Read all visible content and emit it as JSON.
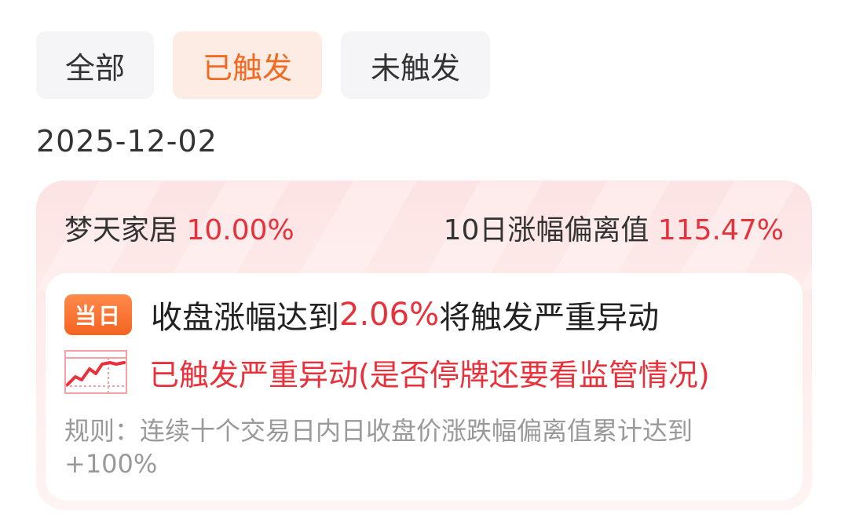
{
  "tabs": {
    "all": "全部",
    "triggered": "已触发",
    "untriggered": "未触发"
  },
  "date": "2025-12-02",
  "stock": {
    "name": "梦天家居",
    "change": "10.00%",
    "deviation_label": "10日涨幅偏离值",
    "deviation_value": "115.47%"
  },
  "alert": {
    "badge": "当日",
    "prefix": "收盘涨幅达到",
    "threshold": "2.06%",
    "suffix": "将触发严重异动",
    "status": "已触发严重异动(是否停牌还要看监管情况)",
    "rule": "规则：连续十个交易日内日收盘价涨跌幅偏离值累计达到+100%"
  },
  "colors": {
    "accent_orange": "#f26a21",
    "alert_red": "#e8313a",
    "muted_gray": "#999999"
  }
}
